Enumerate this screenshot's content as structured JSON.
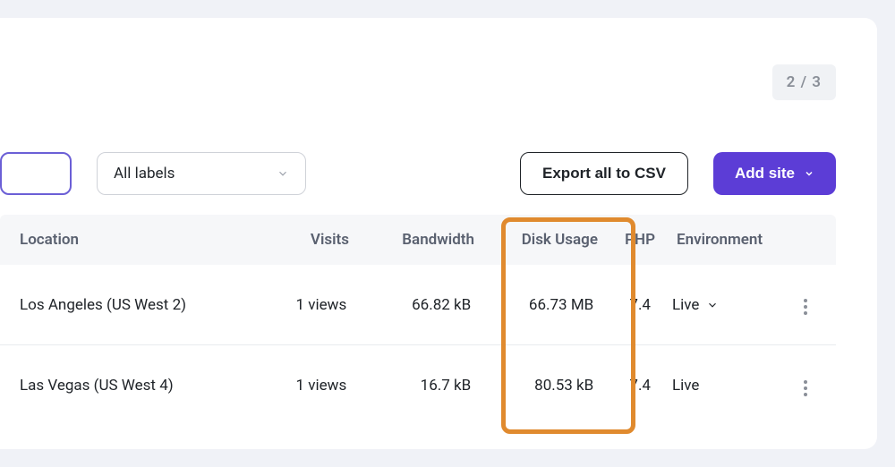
{
  "page_indicator": "2 / 3",
  "controls": {
    "labels_dropdown": "All labels",
    "export_button": "Export all to CSV",
    "add_site_button": "Add site"
  },
  "columns": {
    "location": "Location",
    "visits": "Visits",
    "bandwidth": "Bandwidth",
    "disk": "Disk Usage",
    "php": "PHP",
    "environment": "Environment"
  },
  "rows": [
    {
      "location": "Los Angeles (US West 2)",
      "visits": "1 views",
      "bandwidth": "66.82 kB",
      "disk": "66.73 MB",
      "php": "7.4",
      "environment": "Live",
      "env_expandable": true
    },
    {
      "location": "Las Vegas (US West 4)",
      "visits": "1 views",
      "bandwidth": "16.7 kB",
      "disk": "80.53 kB",
      "php": "7.4",
      "environment": "Live",
      "env_expandable": false
    }
  ],
  "highlighted_column": "disk"
}
